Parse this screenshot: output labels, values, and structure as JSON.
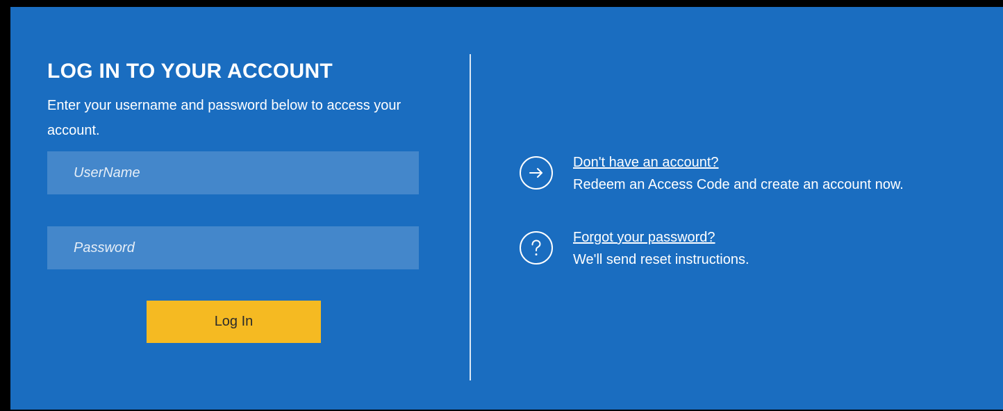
{
  "login": {
    "title": "LOG IN TO YOUR ACCOUNT",
    "subtitle": "Enter your username and password below to access your account.",
    "username_placeholder": "UserName",
    "password_placeholder": "Password",
    "login_button": "Log In"
  },
  "links": {
    "create_account": {
      "icon": "arrow-right-circle-icon",
      "label": "Don't have an account?",
      "description": "Redeem an Access Code and create an account now."
    },
    "forgot_password": {
      "icon": "question-circle-icon",
      "label": "Forgot your password?",
      "description": "We'll send reset instructions."
    }
  },
  "colors": {
    "panel_background": "#1A6DC0",
    "input_background": "#4487CB",
    "button_background": "#F5BA22",
    "frame_border": "#000000"
  }
}
